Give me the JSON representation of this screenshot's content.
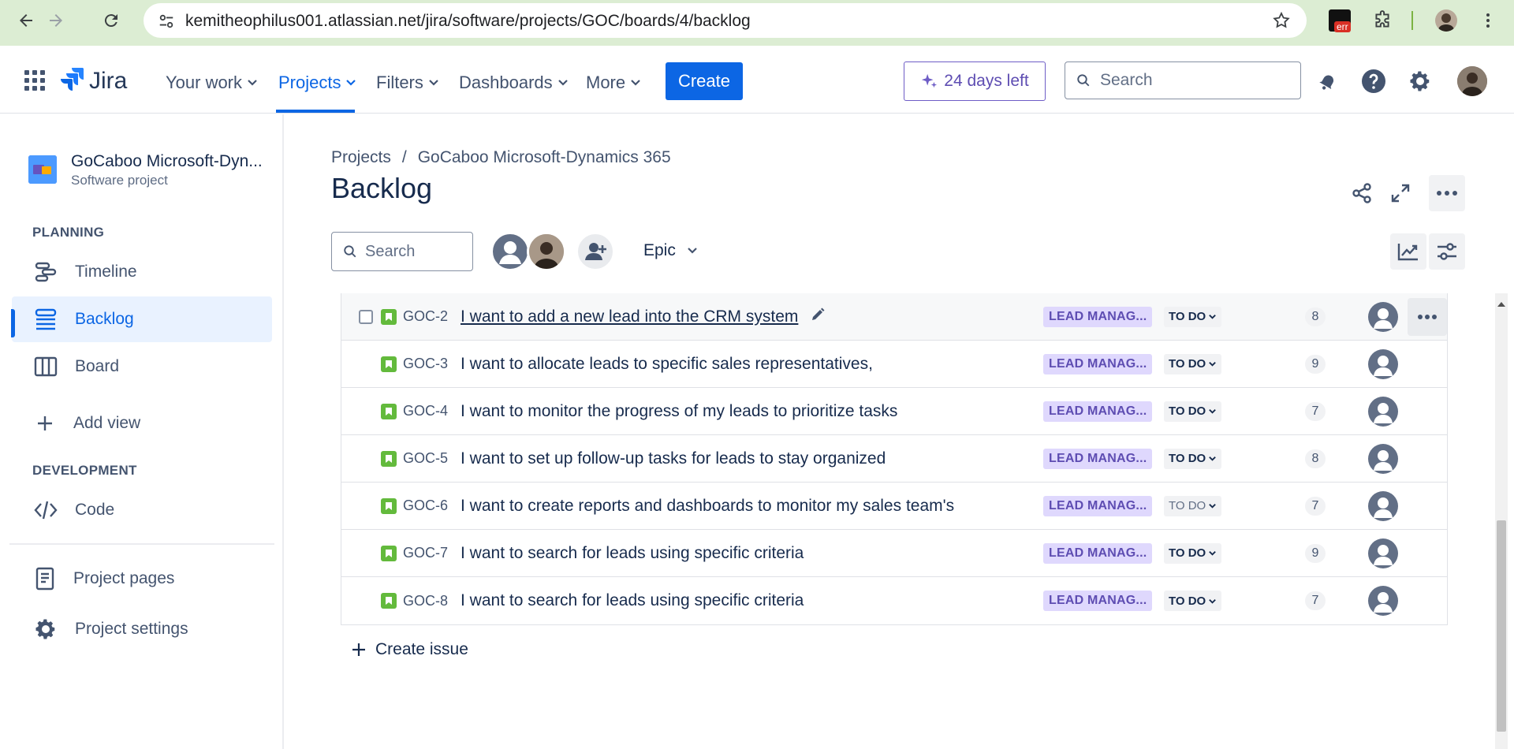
{
  "browser": {
    "url": "kemitheophilus001.atlassian.net/jira/software/projects/GOC/boards/4/backlog",
    "extension_badge": "err"
  },
  "topnav": {
    "logo_text": "Jira",
    "items": [
      "Your work",
      "Projects",
      "Filters",
      "Dashboards",
      "More"
    ],
    "active_item": "Projects",
    "create_label": "Create",
    "trial_label": "24 days left",
    "search_placeholder": "Search"
  },
  "sidebar": {
    "project_name": "GoCaboo Microsoft-Dyn...",
    "project_type": "Software project",
    "planning_heading": "PLANNING",
    "planning_items": [
      "Timeline",
      "Backlog",
      "Board"
    ],
    "active_item": "Backlog",
    "add_view_label": "Add view",
    "development_heading": "DEVELOPMENT",
    "development_items": [
      "Code"
    ],
    "project_pages_label": "Project pages",
    "project_settings_label": "Project settings"
  },
  "main": {
    "breadcrumbs": [
      "Projects",
      "GoCaboo Microsoft-Dynamics 365"
    ],
    "breadcrumb_separator": "/",
    "title": "Backlog",
    "search_placeholder": "Search",
    "epic_filter_label": "Epic",
    "create_issue_label": "Create issue"
  },
  "issues": [
    {
      "key": "GOC-2",
      "summary": "I want to add a new lead into the CRM system",
      "epic": "LEAD MANAG...",
      "status": "TO DO",
      "points": "8"
    },
    {
      "key": "GOC-3",
      "summary": "I want to allocate leads to specific sales representatives,",
      "epic": "LEAD MANAG...",
      "status": "TO DO",
      "points": "9"
    },
    {
      "key": "GOC-4",
      "summary": "I want to monitor the progress of my leads to prioritize tasks",
      "epic": "LEAD MANAG...",
      "status": "TO DO",
      "points": "7"
    },
    {
      "key": "GOC-5",
      "summary": "I want to set up follow-up tasks for leads to stay organized",
      "epic": "LEAD MANAG...",
      "status": "TO DO",
      "points": "8"
    },
    {
      "key": "GOC-6",
      "summary": "I want to create reports and dashboards to monitor my sales team's",
      "epic": "LEAD MANAG...",
      "status": "TO DO",
      "points": "7"
    },
    {
      "key": "GOC-7",
      "summary": "I want to search for leads using specific criteria",
      "epic": "LEAD MANAG...",
      "status": "TO DO",
      "points": "9"
    },
    {
      "key": "GOC-8",
      "summary": "I want to search for leads using specific criteria",
      "epic": "LEAD MANAG...",
      "status": "TO DO",
      "points": "7"
    }
  ],
  "colors": {
    "brand_blue": "#0c66e4",
    "story_green": "#63ba3c",
    "epic_purple_bg": "#dfd8fd",
    "epic_purple_text": "#5e4db2",
    "browser_bar": "#dcedd3"
  }
}
